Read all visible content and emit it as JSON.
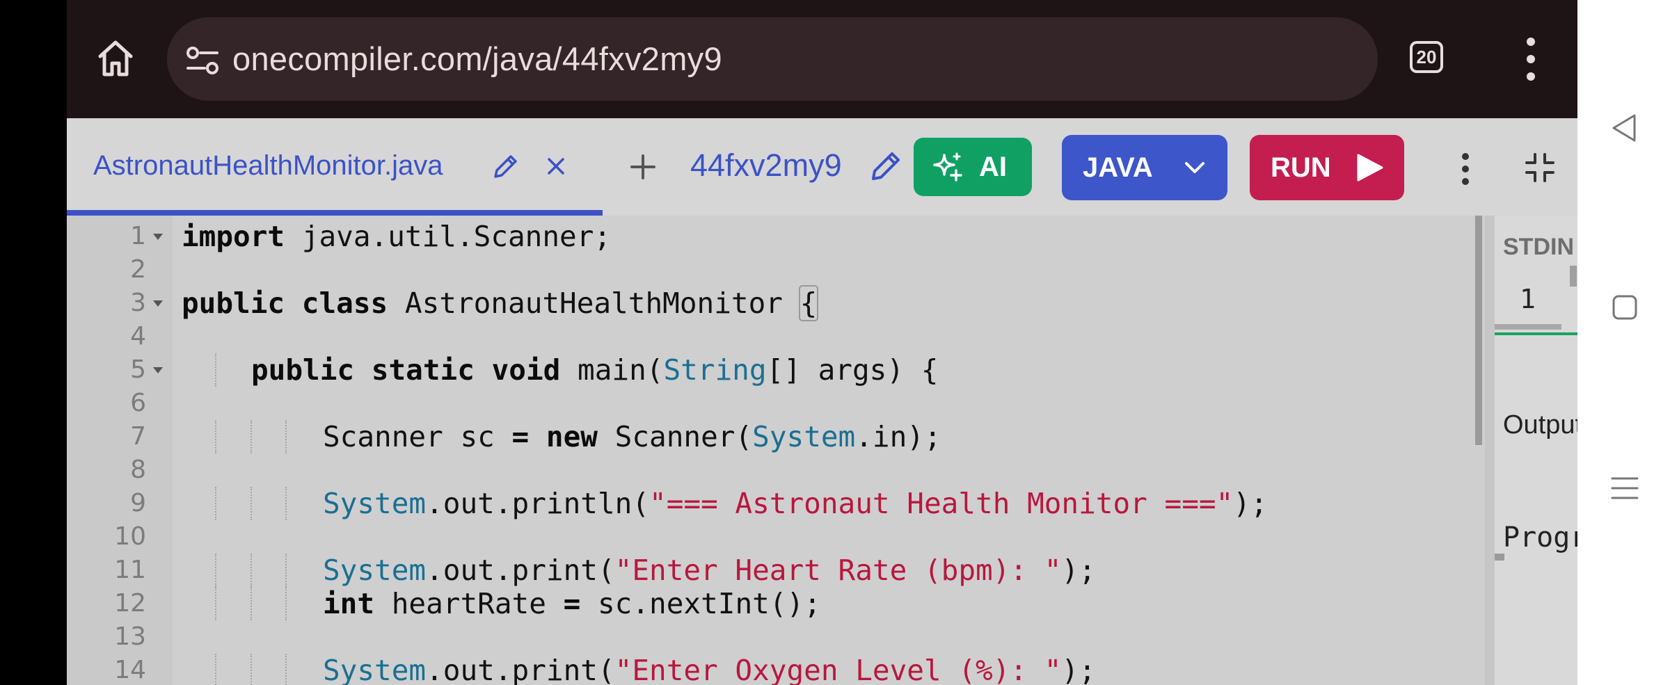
{
  "browser": {
    "url": "onecompiler.com/java/44fxv2my9",
    "tab_count": "20"
  },
  "toolbar": {
    "file_tab": "AstronautHealthMonitor.java",
    "project_name": "44fxv2my9",
    "ai_label": "AI",
    "language_label": "JAVA",
    "run_label": "RUN"
  },
  "editor": {
    "lines": [
      {
        "num": "1",
        "fold": true
      },
      {
        "num": "2"
      },
      {
        "num": "3",
        "fold": true
      },
      {
        "num": "4"
      },
      {
        "num": "5",
        "fold": true
      },
      {
        "num": "6"
      },
      {
        "num": "7"
      },
      {
        "num": "8"
      },
      {
        "num": "9"
      },
      {
        "num": "10"
      },
      {
        "num": "11"
      },
      {
        "num": "12"
      },
      {
        "num": "13"
      },
      {
        "num": "14"
      }
    ],
    "tokens": {
      "l1_kw": "import",
      "l1_rest": " java.util.Scanner;",
      "l3_kw": "public class",
      "l3_name": " AstronautHealthMonitor ",
      "l3_brace": "{",
      "l5_kw": "public static void",
      "l5_a": " main(",
      "l5_type": "String",
      "l5_b": "[] args) {",
      "l7_a": "Scanner sc ",
      "l7_eq": "=",
      "l7_b": " ",
      "l7_kw": "new",
      "l7_c": " Scanner(",
      "l7_type": "System",
      "l7_d": ".in);",
      "l9_type": "System",
      "l9_a": ".out.println(",
      "l9_str": "\"=== Astronaut Health Monitor ===\"",
      "l9_b": ");",
      "l11_type": "System",
      "l11_a": ".out.print(",
      "l11_str": "\"Enter Heart Rate (bpm): \"",
      "l11_b": ");",
      "l12_kw": "int",
      "l12_a": " heartRate ",
      "l12_eq": "=",
      "l12_b": " sc.nextInt();",
      "l14_type": "System",
      "l14_a": ".out.print(",
      "l14_str": "\"Enter Oxygen Level (%): \"",
      "l14_b": ");"
    }
  },
  "right_panel": {
    "stdin_label": "STDIN",
    "stdin_line_number": "1",
    "output_label": "Output",
    "program_text": "Program"
  },
  "colors": {
    "ai_button": "#10a064",
    "language_button": "#3d56c9",
    "run_button": "#c41d4f",
    "tab_accent": "#3b52c7",
    "string": "#b8173d",
    "type": "#1a6f93"
  },
  "icons": {
    "home": "home-icon",
    "site_settings": "tune-icon",
    "edit": "pencil-icon",
    "close": "close-icon",
    "add": "plus-icon",
    "ai": "sparkle-icon",
    "chevron": "chevron-down-icon",
    "run": "play-icon",
    "more": "more-vert-icon",
    "collapse": "collapse-icon",
    "nav_back": "back-triangle-icon",
    "nav_home": "home-square-icon",
    "nav_recents": "recents-icon"
  }
}
